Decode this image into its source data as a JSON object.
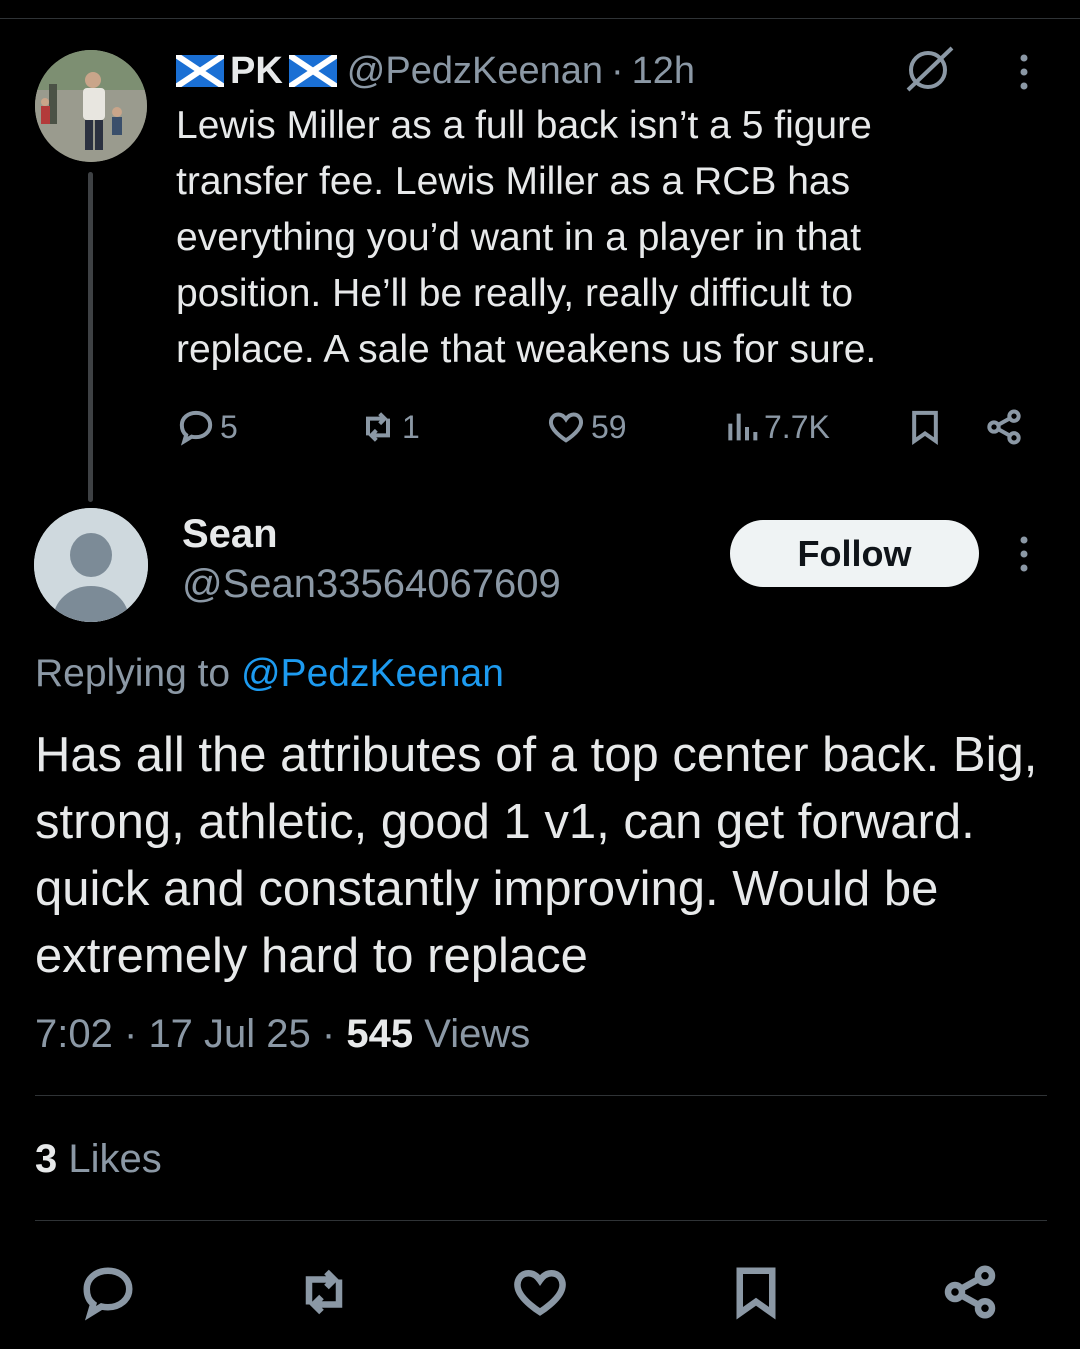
{
  "parent_tweet": {
    "display_name": "PK",
    "handle": "@PedzKeenan",
    "separator": "·",
    "time": "12h",
    "text": "Lewis Miller as a full back isn’t a 5 figure transfer fee. Lewis Miller as a RCB has everything you’d want in a player in that position. He’ll be really, really difficult to replace. A sale that weakens us for sure.",
    "replies": "5",
    "reposts": "1",
    "likes": "59",
    "views": "7.7K"
  },
  "reply": {
    "display_name": "Sean",
    "handle": "@Sean33564067609",
    "follow_label": "Follow",
    "replying_prefix": "Replying to",
    "replying_mention": "@PedzKeenan",
    "text": "Has all the attributes of a top center back. Big, strong, athletic, good 1 v1, can get forward.  quick and constantly improving. Would be extremely hard to replace",
    "time": "7:02",
    "date": "17 Jul 25",
    "separator": "·",
    "views_count": "545",
    "views_label": "Views",
    "likes_count": "3",
    "likes_label": "Likes"
  },
  "icons": {
    "flag": "scotland-flag-icon",
    "grok": "grok-icon",
    "more": "more-vertical-icon",
    "reply": "reply-icon",
    "repost": "repost-icon",
    "like": "heart-icon",
    "views": "views-chart-icon",
    "bookmark": "bookmark-icon",
    "share": "share-icon"
  },
  "colors": {
    "background": "#000000",
    "text": "#e7e9ea",
    "secondary": "#8b98a5",
    "link": "#1d9bf0",
    "follow_bg": "#eff3f4",
    "scotland_blue": "#1a6fd4"
  }
}
